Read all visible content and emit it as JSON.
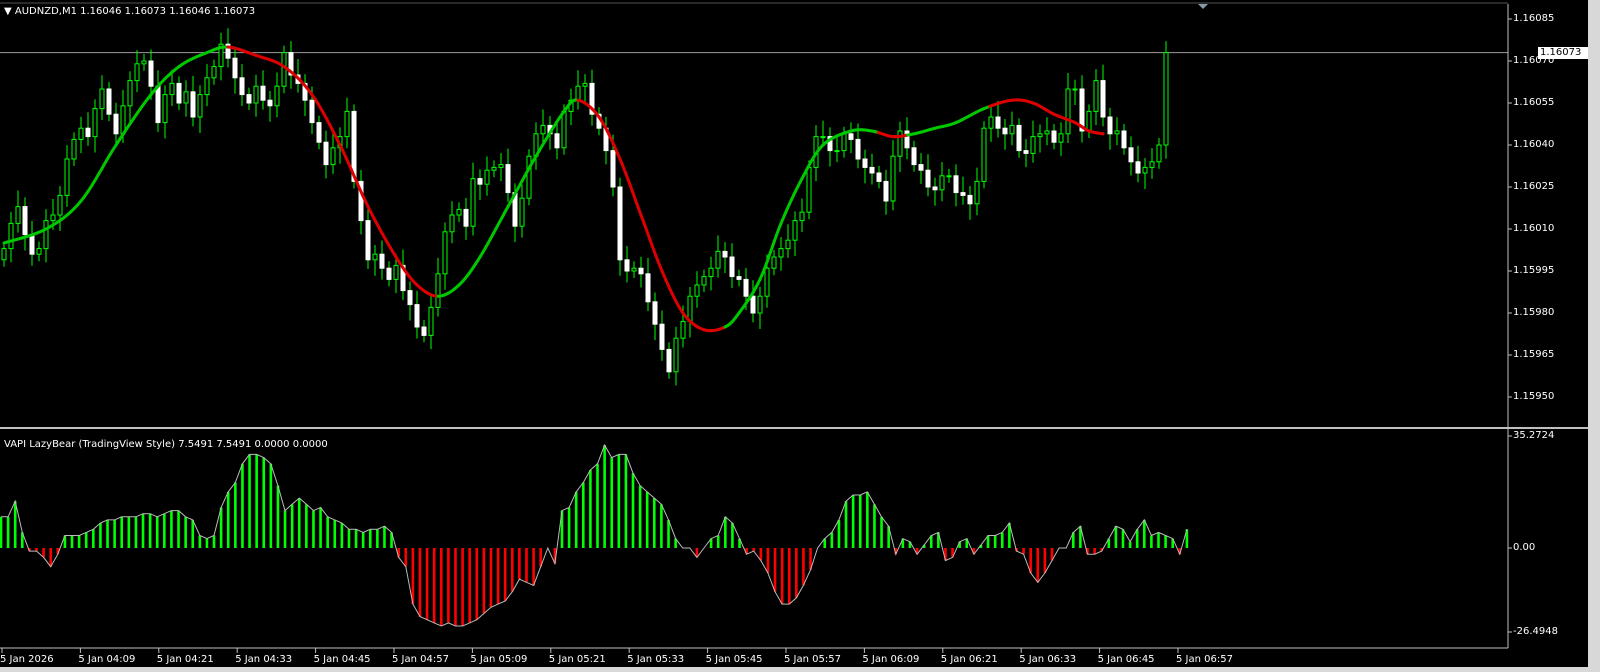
{
  "main_panel": {
    "symbol_header": "AUDNZD,M1  1.16046 1.16073 1.16046 1.16073",
    "current_price": "1.16073",
    "price_axis": [
      "1.16085",
      "1.16070",
      "1.16055",
      "1.16040",
      "1.16025",
      "1.16010",
      "1.15995",
      "1.15980",
      "1.15965",
      "1.15950"
    ]
  },
  "indicator_panel": {
    "title": "VAPI LazyBear (TradingView Style) 7.5491 7.5491 0.0000 0.0000",
    "axis": [
      "35.2724",
      "0.00",
      "-26.4948"
    ]
  },
  "time_axis": [
    "5 Jan 2026",
    "5 Jan 04:09",
    "5 Jan 04:21",
    "5 Jan 04:33",
    "5 Jan 04:45",
    "5 Jan 04:57",
    "5 Jan 05:09",
    "5 Jan 05:21",
    "5 Jan 05:33",
    "5 Jan 05:45",
    "5 Jan 05:57",
    "5 Jan 06:09",
    "5 Jan 06:21",
    "5 Jan 06:33",
    "5 Jan 06:45",
    "5 Jan 06:57"
  ],
  "colors": {
    "background": "#000000",
    "bull_candle": "#00ff00",
    "bear_candle": "#ffffff",
    "ma_up": "#00c800",
    "ma_down": "#dd0000",
    "hist_positive": "#00ff00",
    "hist_negative": "#ff0000",
    "grid_border": "#c0c0c0"
  },
  "chart_data": [
    {
      "type": "candlestick",
      "series": [
        {
          "name": "AUDNZD,M1",
          "values": [
            1.16003,
            1.16012,
            1.16018,
            1.16008,
            1.16001,
            1.16003,
            1.16013,
            1.16015,
            1.16022,
            1.16035,
            1.16042,
            1.16046,
            1.16043,
            1.16053,
            1.1606,
            1.16051,
            1.16044,
            1.16054,
            1.16063,
            1.16069,
            1.1607,
            1.16061,
            1.16048,
            1.16058,
            1.16062,
            1.16055,
            1.16059,
            1.1605,
            1.16058,
            1.16064,
            1.16068,
            1.16076,
            1.16071,
            1.16064,
            1.16058,
            1.16055,
            1.16061,
            1.16056,
            1.16054,
            1.16061,
            1.16073,
            1.16065,
            1.16062,
            1.16056,
            1.16048,
            1.16041,
            1.16033,
            1.16039,
            1.16043,
            1.16052,
            1.16027,
            1.16013,
            1.15999,
            1.16001,
            1.15996,
            1.15992,
            1.15997,
            1.15988,
            1.15983,
            1.15975,
            1.15972,
            1.15982,
            1.15994,
            1.16009,
            1.16015,
            1.16017,
            1.16011,
            1.16028,
            1.16026,
            1.16031,
            1.16032,
            1.16033,
            1.16023,
            1.16011,
            1.16021,
            1.16036,
            1.16044,
            1.16047,
            1.16044,
            1.16039,
            1.16052,
            1.16056,
            1.16061,
            1.16062,
            1.16051,
            1.16046,
            1.16038,
            1.16025,
            1.15999,
            1.15995,
            1.15996,
            1.15994,
            1.15984,
            1.15976,
            1.15967,
            1.15959,
            1.15971,
            1.15977,
            1.15986,
            1.1599,
            1.15993,
            1.15996,
            1.16002,
            1.16,
            1.15993,
            1.15992,
            1.15986,
            1.1598,
            1.15986,
            1.15996,
            1.16,
            1.16003,
            1.16006,
            1.16013,
            1.16016,
            1.16032,
            1.16043,
            1.16043,
            1.16038,
            1.16038,
            1.16044,
            1.16042,
            1.16035,
            1.16032,
            1.1603,
            1.16027,
            1.1602,
            1.16036,
            1.16045,
            1.16039,
            1.16033,
            1.16031,
            1.16025,
            1.16024,
            1.16029,
            1.16029,
            1.16023,
            1.16022,
            1.16019,
            1.16027,
            1.16046,
            1.1605,
            1.16046,
            1.16044,
            1.16047,
            1.16038,
            1.16037,
            1.16043,
            1.16044,
            1.16045,
            1.16041,
            1.16044,
            1.1606,
            1.1606,
            1.16045,
            1.16052,
            1.16063,
            1.1605,
            1.16044,
            1.16045,
            1.16039,
            1.16034,
            1.1603,
            1.16032,
            1.16034,
            1.1604,
            1.16073
          ]
        }
      ]
    },
    {
      "type": "line",
      "series": [
        {
          "name": "MA",
          "points": [
            [
              0,
              1.16005
            ],
            [
              6,
              1.1601
            ],
            [
              11,
              1.1602
            ],
            [
              16,
              1.1604
            ],
            [
              21,
              1.16058
            ],
            [
              25,
              1.16068
            ],
            [
              29,
              1.16073
            ],
            [
              32,
              1.16075
            ],
            [
              36,
              1.16072
            ],
            [
              40,
              1.16068
            ],
            [
              44,
              1.16058
            ],
            [
              48,
              1.1604
            ],
            [
              52,
              1.16018
            ],
            [
              56,
              1.16
            ],
            [
              59,
              1.1599
            ],
            [
              62,
              1.15986
            ],
            [
              65,
              1.1599
            ],
            [
              68,
              1.16
            ],
            [
              72,
              1.16018
            ],
            [
              76,
              1.16036
            ],
            [
              80,
              1.16052
            ],
            [
              82,
              1.16056
            ],
            [
              85,
              1.1605
            ],
            [
              88,
              1.16035
            ],
            [
              91,
              1.16015
            ],
            [
              94,
              1.15995
            ],
            [
              97,
              1.1598
            ],
            [
              100,
              1.15974
            ],
            [
              103,
              1.15975
            ],
            [
              105,
              1.1598
            ],
            [
              108,
              1.15992
            ],
            [
              111,
              1.16012
            ],
            [
              114,
              1.16028
            ],
            [
              117,
              1.1604
            ],
            [
              121,
              1.16045
            ],
            [
              124,
              1.16045
            ],
            [
              127,
              1.16043
            ],
            [
              130,
              1.16044
            ],
            [
              133,
              1.16046
            ],
            [
              136,
              1.16048
            ],
            [
              140,
              1.16053
            ],
            [
              144,
              1.16056
            ],
            [
              147,
              1.16055
            ],
            [
              150,
              1.16051
            ],
            [
              153,
              1.16048
            ],
            [
              155,
              1.16045
            ],
            [
              157,
              1.16044
            ]
          ],
          "down_ranges": [
            [
              32,
              62
            ],
            [
              82,
              103
            ],
            [
              125,
              129
            ],
            [
              141,
              157
            ]
          ]
        }
      ]
    },
    {
      "type": "bar",
      "series": [
        {
          "name": "VAPI",
          "values": [
            10,
            10,
            15,
            5,
            -1,
            -1,
            -3,
            -6,
            -2,
            4,
            4,
            4,
            5,
            6,
            8,
            9,
            9,
            10,
            10,
            10,
            11,
            11,
            10,
            11,
            12,
            12,
            10,
            9,
            4,
            3,
            4,
            13,
            18,
            21,
            27,
            30,
            30,
            29,
            27,
            20,
            12,
            14,
            16,
            14,
            12,
            13,
            10,
            9,
            8,
            6,
            6,
            5,
            6,
            6,
            7,
            5,
            -3,
            -6,
            -18,
            -22,
            -23,
            -24,
            -25,
            -24,
            -25,
            -25,
            -24,
            -23,
            -21,
            -19,
            -18,
            -17,
            -14,
            -10,
            -11,
            -12,
            -6,
            0,
            -5,
            12,
            13,
            18,
            21,
            25,
            27,
            33,
            29,
            30,
            30,
            24,
            20,
            18,
            16,
            14,
            9,
            3,
            0,
            0,
            -3,
            0,
            3,
            4,
            10,
            8,
            3,
            -2,
            -1,
            -4,
            -8,
            -14,
            -18,
            -18,
            -16,
            -12,
            -7,
            0,
            3,
            5,
            9,
            15,
            17,
            17,
            18,
            14,
            10,
            7,
            -2,
            3,
            2,
            -2,
            1,
            4,
            5,
            -4,
            -3,
            2,
            3,
            -2,
            1,
            4,
            4,
            5,
            8,
            -1,
            -2,
            -8,
            -11,
            -8,
            -4,
            0,
            0,
            5,
            7,
            -2,
            -2,
            -1,
            3,
            7,
            6,
            2,
            6,
            9,
            4,
            5,
            4,
            3,
            -2,
            6
          ]
        }
      ]
    }
  ]
}
